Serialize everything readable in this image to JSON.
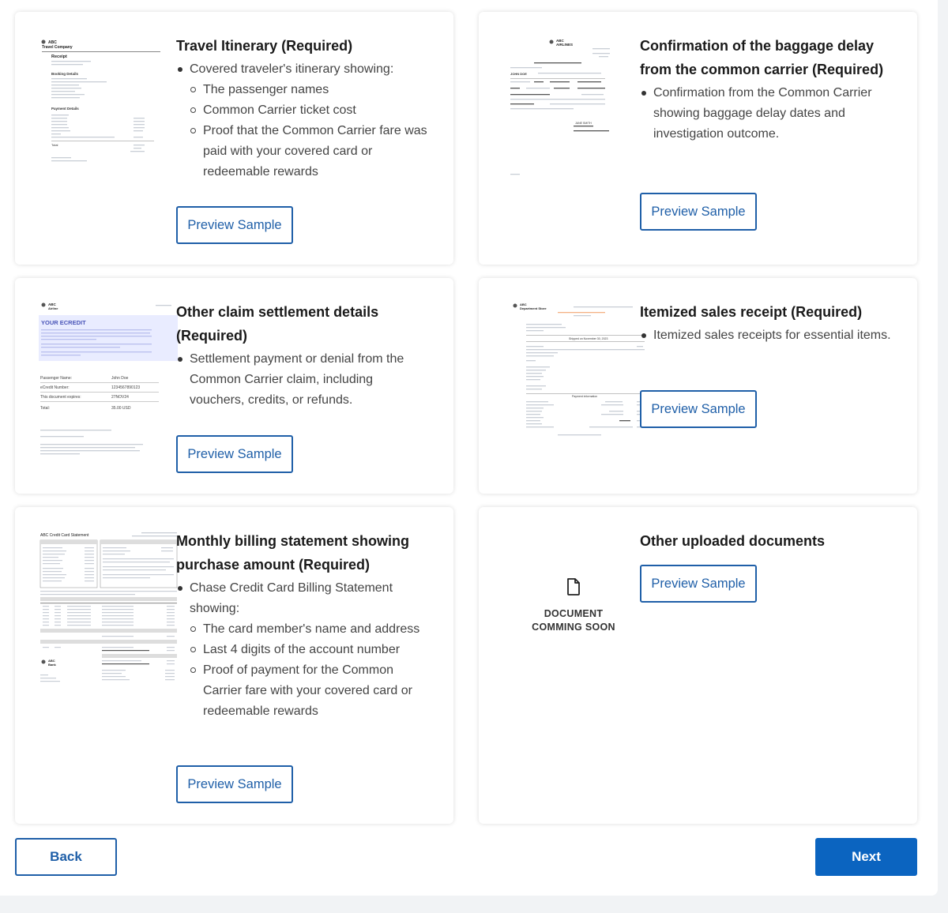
{
  "cards": [
    {
      "title": "Travel Itinerary (Required)",
      "bullet": "Covered traveler's itinerary showing:",
      "subs": [
        "The passenger names",
        "Common Carrier ticket cost",
        "Proof that the Common Carrier fare was paid with your covered card or redeemable rewards"
      ],
      "button": "Preview Sample"
    },
    {
      "title": "Confirmation of the baggage delay from the common carrier (Required)",
      "bullet": "Confirmation from the Common Carrier showing baggage delay dates and investigation outcome.",
      "button": "Preview Sample"
    },
    {
      "title": "Other claim settlement details (Required)",
      "bullet": "Settlement payment or denial from the Common Carrier claim, including vouchers, credits, or refunds.",
      "button": "Preview Sample"
    },
    {
      "title": "Itemized sales receipt (Required)",
      "bullet": "Itemized sales receipts for essential items.",
      "button": "Preview Sample"
    },
    {
      "title": "Monthly billing statement showing purchase amount (Required)",
      "bullet": "Chase Credit Card Billing Statement showing:",
      "subs": [
        "The card member's name and address",
        "Last 4 digits of the account number",
        "Proof of payment for the Common Carrier fare with your covered card or redeemable rewards"
      ],
      "button": "Preview Sample"
    },
    {
      "title": "Other uploaded documents",
      "button": "Preview Sample",
      "placeholder_line1": "DOCUMENT",
      "placeholder_line2": "COMMING SOON"
    }
  ],
  "thumbs": {
    "itinerary": {
      "brand": "ABC",
      "company": "Travel Company",
      "heading": "Receipt",
      "section1": "Booking Details",
      "section2": "Payment Details",
      "total": "Total"
    },
    "baggage": {
      "brand": "ABC",
      "airline": "AIRLINES",
      "name": "JOHN DOE",
      "sign": "JANE SMITH"
    },
    "ecredit": {
      "brand": "ABC",
      "airline": "Airline",
      "banner": "YOUR ECREDIT",
      "rows": [
        [
          "Passenger Name:",
          "John Doe"
        ],
        [
          "eCredit Number:",
          "1234567890123"
        ],
        [
          "This document expires:",
          "27NOV24"
        ],
        [
          "Total:",
          "35.00 USD"
        ]
      ]
    },
    "sales": {
      "brand": "ABC",
      "store": "Department Store",
      "shipped": "Shipped on November 30, 2023",
      "payment": "Payment information"
    },
    "statement": {
      "title": "ABC Credit Card Statement",
      "brand": "ABC",
      "bank": "Bank"
    }
  },
  "footer": {
    "back": "Back",
    "next": "Next"
  },
  "colors": {
    "accent": "#1f5fa8",
    "primary_button": "#0b64c0",
    "ecredit_banner": "#e9ecff"
  }
}
